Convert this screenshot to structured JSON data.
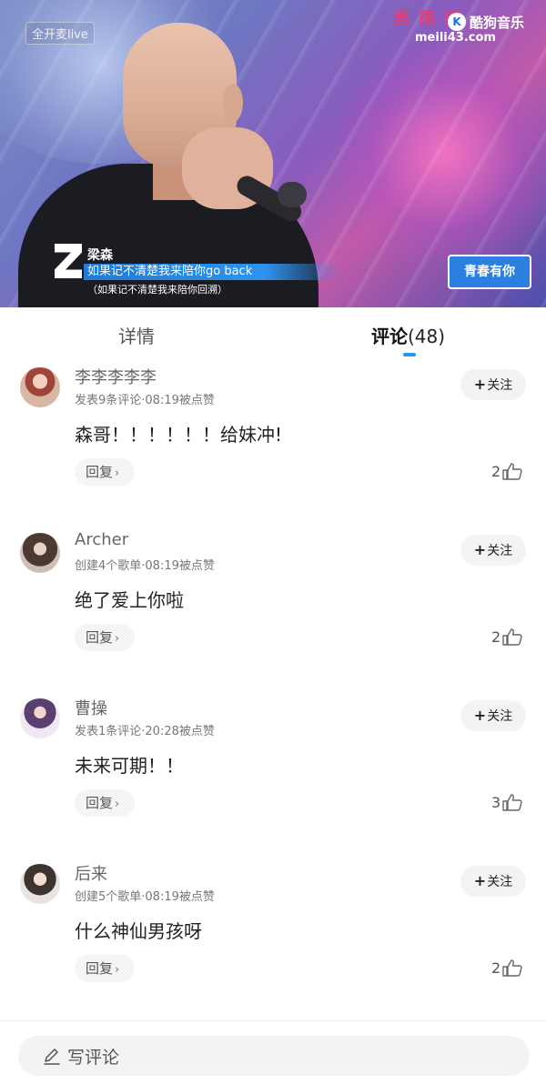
{
  "video": {
    "live_tag": "全开麦live",
    "watermark": "美 丽 网",
    "watermark_url": "meili43.com",
    "brand_icon": "K",
    "brand": "酷狗音乐",
    "singer": "梁森",
    "lyric": "如果记不清楚我来陪你go back",
    "lyric_sub": "（如果记不清楚我来陪你回溯）",
    "show_logo": "青春有你"
  },
  "tabs": {
    "details": "详情",
    "comments": "评论",
    "comments_count": "(48)"
  },
  "comments": [
    {
      "user": "李李李李李",
      "meta": "发表9条评论·08:19被点赞",
      "text": "森哥！！！！！！给妹冲!",
      "likes": "2",
      "follow": "关注",
      "reply": "回复"
    },
    {
      "user": "Archer",
      "meta": "创建4个歌单·08:19被点赞",
      "text": "绝了爱上你啦",
      "likes": "2",
      "follow": "关注",
      "reply": "回复"
    },
    {
      "user": "曹操",
      "meta": "发表1条评论·20:28被点赞",
      "text": "未来可期！！",
      "likes": "3",
      "follow": "关注",
      "reply": "回复"
    },
    {
      "user": "后来",
      "meta": "创建5个歌单·08:19被点赞",
      "text": "什么神仙男孩呀",
      "likes": "2",
      "follow": "关注",
      "reply": "回复"
    }
  ],
  "bottom": {
    "write_comment": "写评论"
  },
  "colors": {
    "accent": "#2196f3",
    "pill_bg": "#f3f3f5"
  },
  "icons": {
    "like": "thumbs-up-icon",
    "write": "pencil-icon",
    "reply": "chevron-right-icon"
  }
}
